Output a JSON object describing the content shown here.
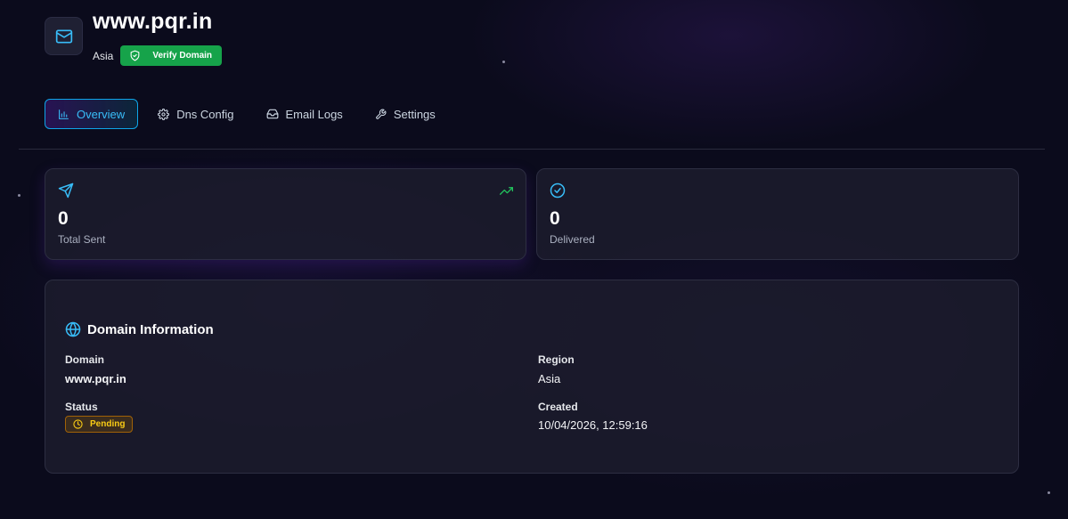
{
  "domain": {
    "name": "www.pqr.in",
    "region": "Asia",
    "verify_label": "Verify Domain"
  },
  "tabs": [
    {
      "label": "Overview",
      "icon": "bar-chart-icon",
      "active": true
    },
    {
      "label": "Dns Config",
      "icon": "gear-icon",
      "active": false
    },
    {
      "label": "Email Logs",
      "icon": "inbox-icon",
      "active": false
    },
    {
      "label": "Settings",
      "icon": "wrench-icon",
      "active": false
    }
  ],
  "stats": [
    {
      "value": "0",
      "label": "Total Sent",
      "icon": "send-icon"
    },
    {
      "value": "0",
      "label": "Delivered",
      "icon": "check-circle-icon"
    }
  ],
  "info": {
    "title": "Domain Information",
    "domain_label": "Domain",
    "domain_value": "www.pqr.in",
    "region_label": "Region",
    "region_value": "Asia",
    "status_label": "Status",
    "status_value": "Pending",
    "created_label": "Created",
    "created_value": "10/04/2026, 12:59:16"
  },
  "colors": {
    "accent": "#38bdf8",
    "success": "#16a34a",
    "warning": "#facc15",
    "background": "#0b0b1c"
  }
}
